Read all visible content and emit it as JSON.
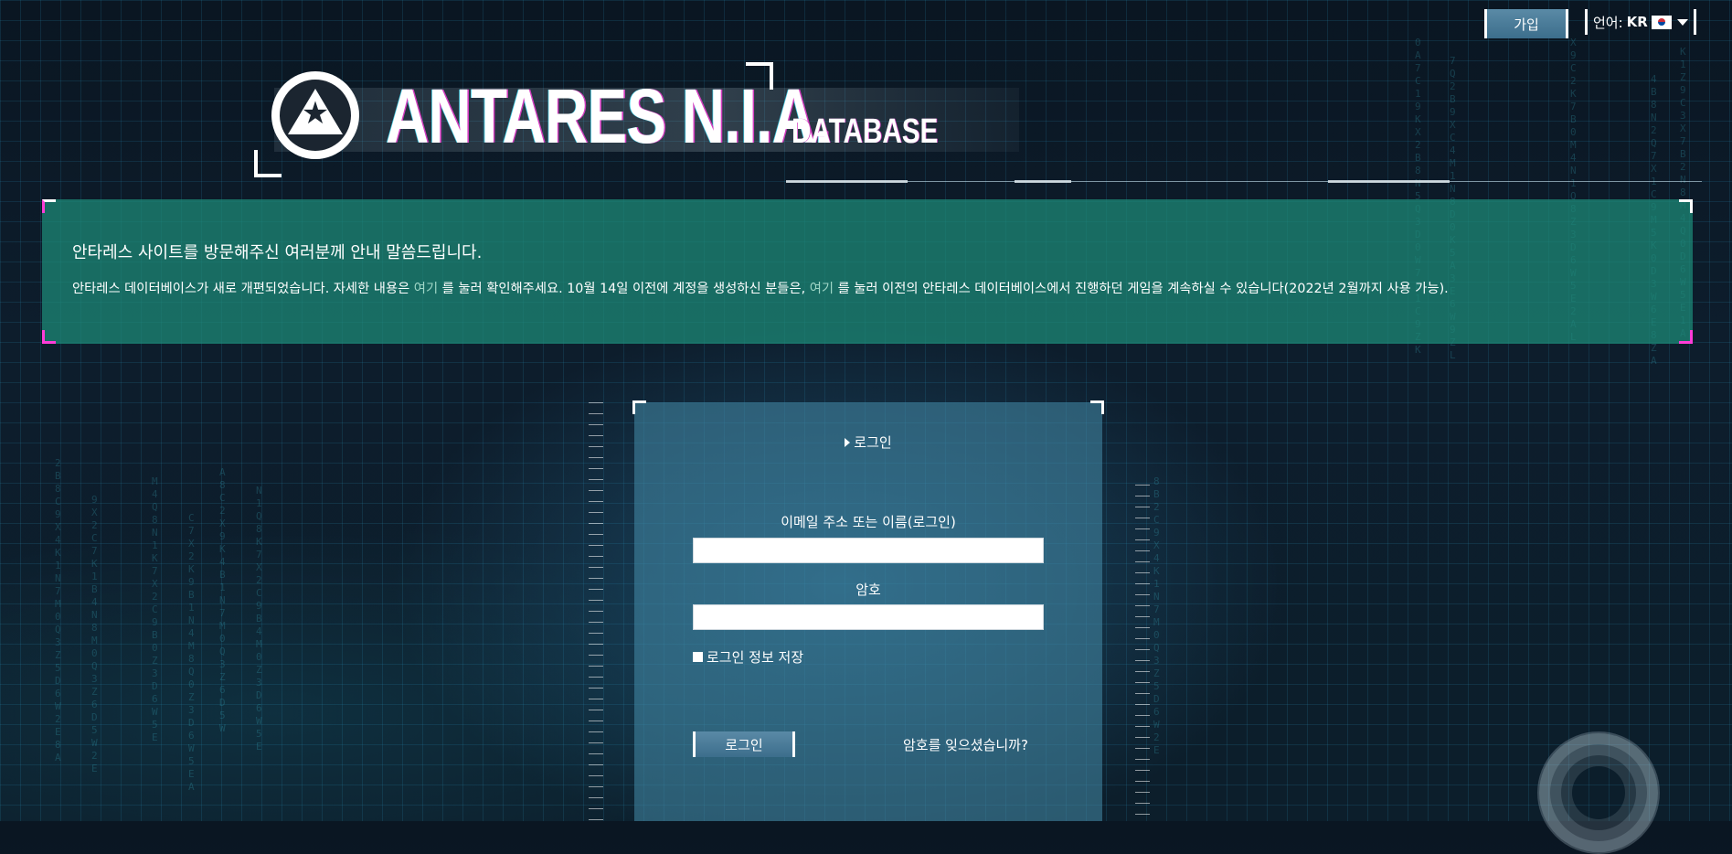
{
  "header": {
    "signup_label": "가입",
    "language_label": "언어:",
    "language_code": "KR",
    "logo_title": "ANTARES N.I.A.",
    "logo_subtitle": "DATABASE"
  },
  "notice": {
    "title": "안타레스 사이트를 방문해주신 여러분께 안내 말씀드립니다.",
    "body_part1": "안타레스 데이터베이스가 새로 개편되었습니다. 자세한 내용은",
    "link1": "여기",
    "body_part2": "를 눌러 확인해주세요. 10월 14일 이전에 계정을 생성하신 분들은,",
    "link2": "여기",
    "body_part3": "를 눌러 이전의 안타레스 데이터베이스에서 진행하던 게임을 계속하실 수 있습니다(2022년 2월까지 사용 가능)."
  },
  "login": {
    "heading": "로그인",
    "email_label": "이메일 주소 또는 이름(로그인)",
    "email_value": "",
    "password_label": "암호",
    "password_value": "",
    "remember_label": "로그인 정보 저장",
    "submit_label": "로그인",
    "forgot_label": "암호를 잊으셨습니까?"
  },
  "icons": {
    "flag": "korea-flag-icon",
    "caret": "chevron-down-icon",
    "emblem": "antares-star-emblem"
  }
}
